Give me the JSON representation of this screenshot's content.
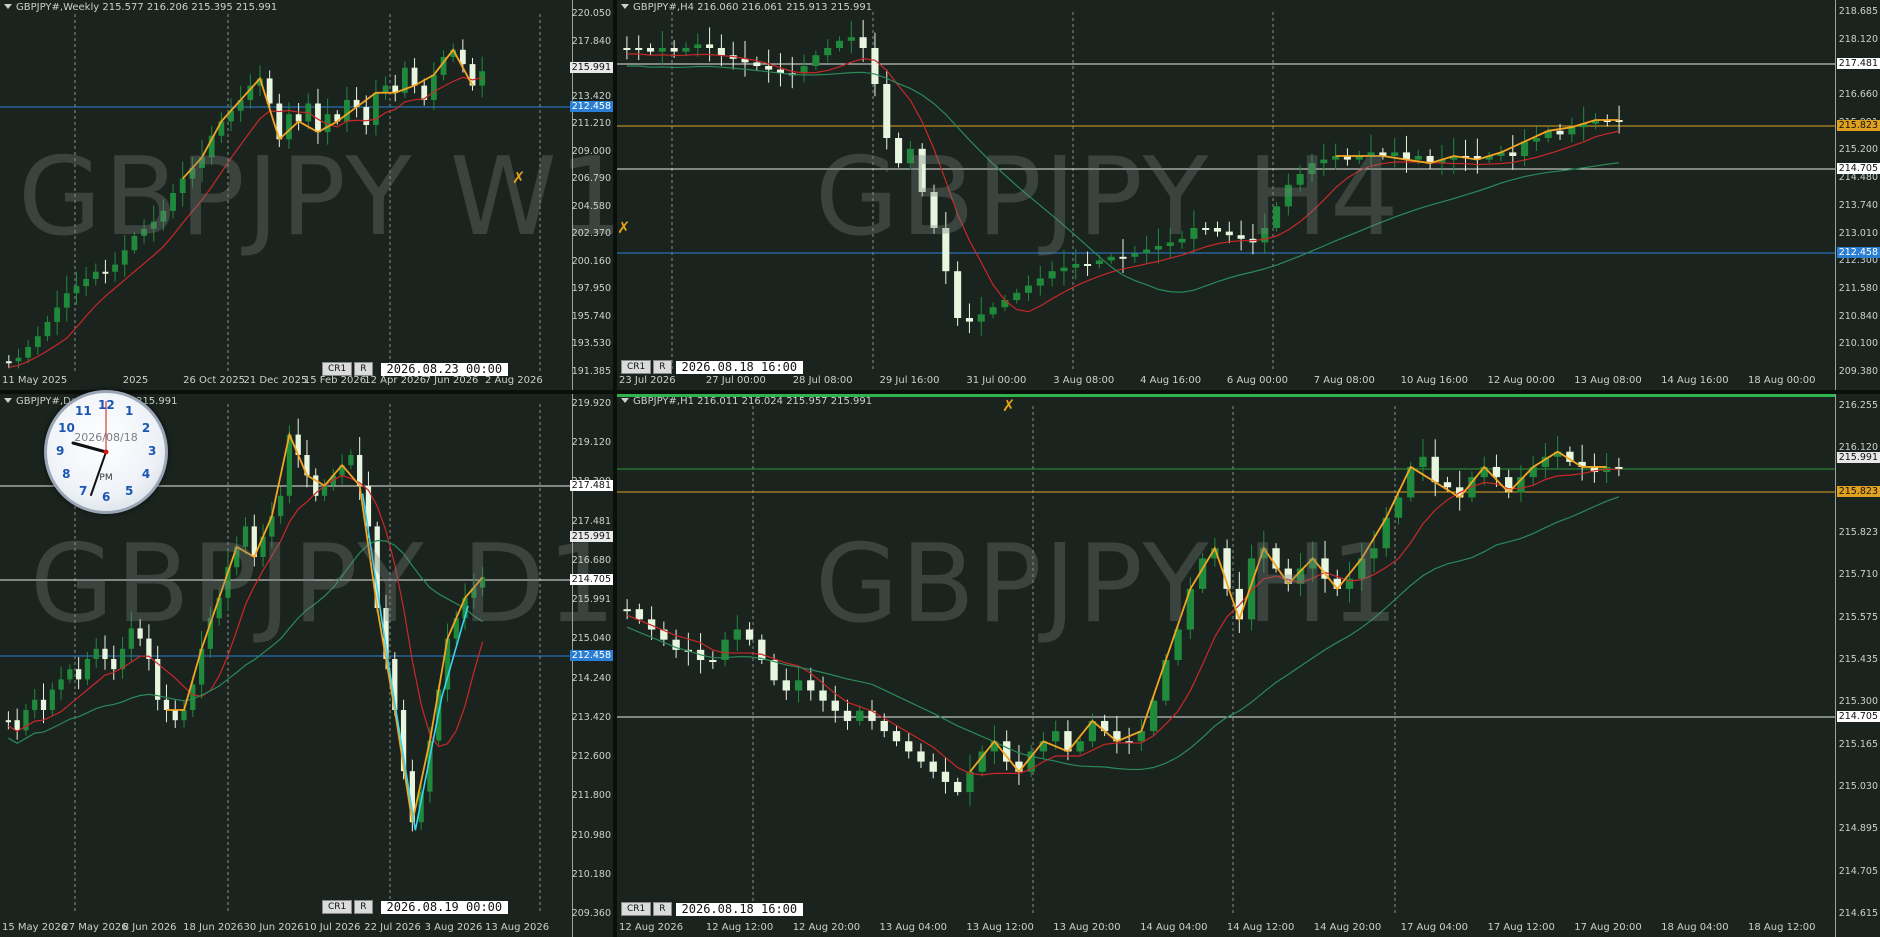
{
  "panels": {
    "w1": {
      "title": "GBPJPY#,Weekly  215.577 216.206 215.395 215.991",
      "watermark": "GBPJPY W1",
      "y_labels": [
        "220.050",
        "217.840",
        "215.630",
        "213.420",
        "211.210",
        "209.000",
        "206.790",
        "204.580",
        "202.370",
        "200.160",
        "197.950",
        "195.740",
        "193.530",
        "191.385"
      ],
      "price_tags": [
        {
          "text": "215.991",
          "type": "current"
        },
        {
          "text": "212.458",
          "type": "blue"
        }
      ],
      "x_labels": [
        "11 May 2025",
        "",
        "2025",
        "26 Oct 2025",
        "21 Dec 2025",
        "15 Feb 2026",
        "12 Apr 2026",
        "7 Jun 2026",
        "2 Aug 2026"
      ],
      "buttons": [
        "CR1",
        "R"
      ],
      "date": "2026.08.23 00:00"
    },
    "h4": {
      "title": "GBPJPY#,H4  216.060 216.061 215.913 215.991",
      "watermark": "GBPJPY H4",
      "y_labels": [
        "218.685",
        "218.120",
        "217.481",
        "216.660",
        "215.991",
        "215.200",
        "214.480",
        "213.740",
        "213.010",
        "212.300",
        "211.580",
        "210.840",
        "210.100",
        "209.380"
      ],
      "price_tags": [
        {
          "text": "217.481",
          "type": "white"
        },
        {
          "text": "215.823",
          "type": "orange"
        },
        {
          "text": "214.705",
          "type": "white"
        },
        {
          "text": "212.458",
          "type": "blue"
        }
      ],
      "x_labels": [
        "23 Jul 2026",
        "27 Jul 00:00",
        "28 Jul 08:00",
        "29 Jul 16:00",
        "31 Jul 00:00",
        "3 Aug 08:00",
        "4 Aug 16:00",
        "6 Aug 00:00",
        "7 Aug 08:00",
        "10 Aug 16:00",
        "12 Aug 00:00",
        "13 Aug 08:00",
        "14 Aug 16:00",
        "18 Aug 00:00"
      ],
      "buttons": [
        "CR1",
        "R"
      ],
      "date": "2026.08.18 16:00"
    },
    "d1": {
      "title": "GBPJPY#,Daily  215.672 215.991",
      "watermark": "GBPJPY D1",
      "y_labels": [
        "219.920",
        "219.120",
        "218.300",
        "217.481",
        "216.680",
        "215.991",
        "215.040",
        "214.240",
        "213.420",
        "212.600",
        "211.800",
        "210.980",
        "210.180",
        "209.360"
      ],
      "price_tags": [
        {
          "text": "217.481",
          "type": "white"
        },
        {
          "text": "215.991",
          "type": "current"
        },
        {
          "text": "214.705",
          "type": "white"
        },
        {
          "text": "212.458",
          "type": "blue"
        }
      ],
      "x_labels": [
        "15 May 2026",
        "27 May 2026",
        "8 Jun 2026",
        "18 Jun 2026",
        "30 Jun 2026",
        "10 Jul 2026",
        "22 Jul 2026",
        "3 Aug 2026",
        "13 Aug 2026"
      ],
      "buttons": [
        "CR1",
        "R"
      ],
      "date": "2026.08.19 00:00"
    },
    "h1": {
      "title": "GBPJPY#,H1  216.011 216.024 215.957 215.991",
      "watermark": "GBPJPY H1",
      "y_labels": [
        "216.255",
        "216.120",
        "215.991",
        "215.823",
        "215.710",
        "215.575",
        "215.435",
        "215.300",
        "215.165",
        "215.030",
        "214.895",
        "214.705",
        "214.615"
      ],
      "price_tags": [
        {
          "text": "215.991",
          "type": "current"
        },
        {
          "text": "215.823",
          "type": "orange"
        },
        {
          "text": "214.705",
          "type": "white"
        }
      ],
      "x_labels": [
        "12 Aug 2026",
        "12 Aug 12:00",
        "12 Aug 20:00",
        "13 Aug 04:00",
        "13 Aug 12:00",
        "13 Aug 20:00",
        "14 Aug 04:00",
        "14 Aug 12:00",
        "14 Aug 20:00",
        "17 Aug 04:00",
        "17 Aug 12:00",
        "17 Aug 20:00",
        "18 Aug 04:00",
        "18 Aug 12:00"
      ],
      "buttons": [
        "CR1",
        "R"
      ],
      "date": "2026.08.18 16:00"
    }
  },
  "clock": {
    "date": "2026/08/18",
    "period": "PM",
    "numbers": [
      "12",
      "1",
      "2",
      "3",
      "4",
      "5",
      "6",
      "7",
      "8",
      "9",
      "10",
      "11"
    ]
  },
  "colors": {
    "background": "#1b231e",
    "bull": "#1f8a3c",
    "bear": "#e8f6df",
    "zigzag": "#f2a623",
    "zigzag_cyan": "#39d4f0",
    "ma_red": "#c82828",
    "ma_green": "#2a8a5a",
    "level_blue": "#2a7fd4",
    "level_orange": "#e0a020",
    "level_white": "#e8e8e8"
  }
}
